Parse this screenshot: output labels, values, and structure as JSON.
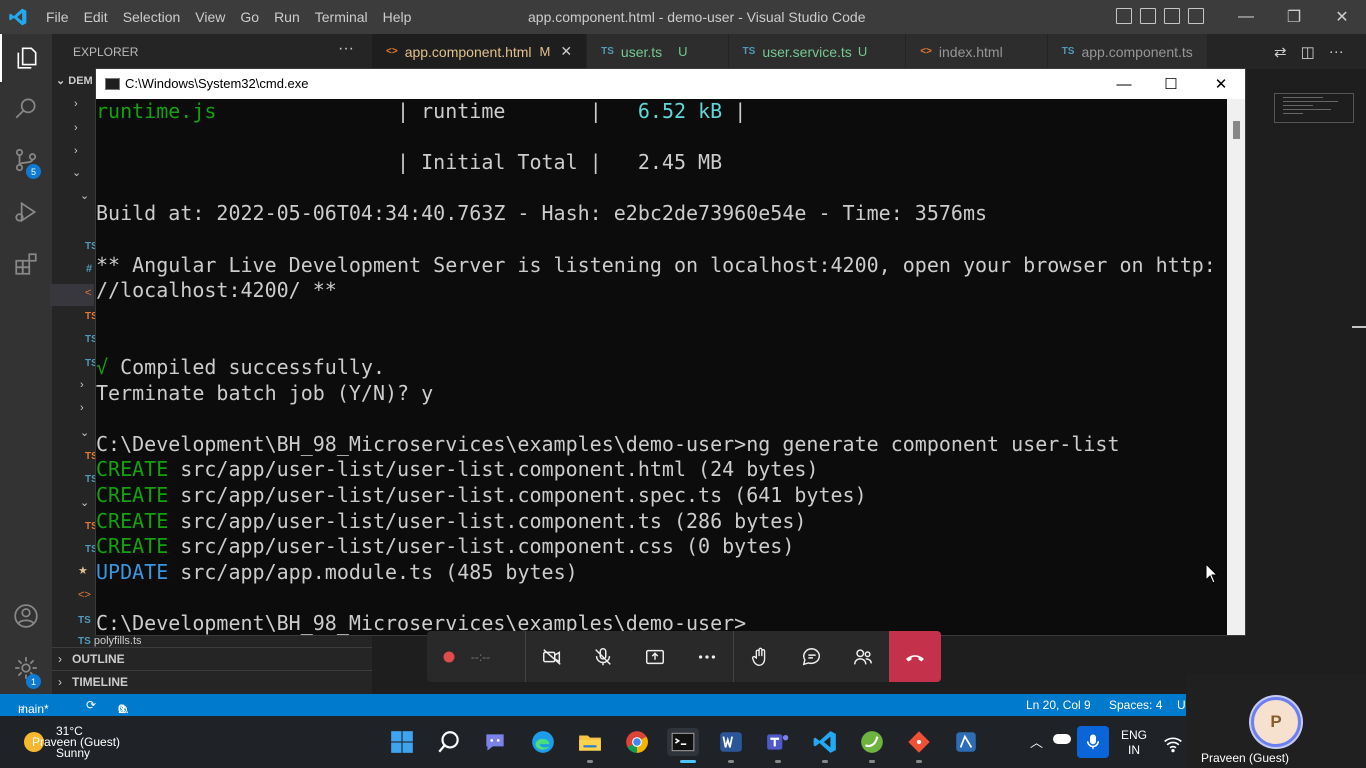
{
  "titlebar": {
    "menu": [
      "File",
      "Edit",
      "Selection",
      "View",
      "Go",
      "Run",
      "Terminal",
      "Help"
    ],
    "title": "app.component.html - demo-user - Visual Studio Code"
  },
  "activity": {
    "scm_badge": "5",
    "settings_badge": "1"
  },
  "sidebar": {
    "header": "EXPLORER",
    "more": "···",
    "root_fragment": "DEM",
    "bottom_file": "polyfills.ts",
    "sections": [
      "OUTLINE",
      "TIMELINE"
    ]
  },
  "tabs": [
    {
      "icon": "<>",
      "label": "app.component.html",
      "status": "M",
      "close": "✕",
      "active": true
    },
    {
      "icon": "TS",
      "label": "user.ts",
      "status": "U",
      "active": false
    },
    {
      "icon": "TS",
      "label": "user.service.ts",
      "status": "U",
      "active": false
    },
    {
      "icon": "<>",
      "label": "index.html",
      "status": "",
      "active": false
    },
    {
      "icon": "TS",
      "label": "app.component.ts",
      "status": "",
      "active": false
    }
  ],
  "cmd": {
    "title": "C:\\Windows\\System32\\cmd.exe",
    "lines": [
      {
        "segs": [
          {
            "t": "runtime.js",
            "c": "g"
          },
          {
            "t": "               | runtime       |   "
          },
          {
            "t": "6.52 kB",
            "c": "c"
          },
          {
            "t": " |"
          }
        ]
      },
      {
        "segs": [
          {
            "t": ""
          }
        ]
      },
      {
        "segs": [
          {
            "t": "                         | Initial Total |   2.45 MB"
          }
        ]
      },
      {
        "segs": [
          {
            "t": ""
          }
        ]
      },
      {
        "segs": [
          {
            "t": "Build at: 2022-05-06T04:34:40.763Z - Hash: e2bc2de73960e54e - Time: 3576ms"
          }
        ]
      },
      {
        "segs": [
          {
            "t": ""
          }
        ]
      },
      {
        "segs": [
          {
            "t": "** Angular Live Development Server is listening on localhost:4200, open your browser on http:"
          }
        ]
      },
      {
        "segs": [
          {
            "t": "//localhost:4200/ **"
          }
        ]
      },
      {
        "segs": [
          {
            "t": ""
          }
        ]
      },
      {
        "segs": [
          {
            "t": ""
          }
        ]
      },
      {
        "segs": [
          {
            "t": "√",
            "c": "g"
          },
          {
            "t": " Compiled successfully."
          }
        ]
      },
      {
        "segs": [
          {
            "t": "Terminate batch job (Y/N)? y"
          }
        ]
      },
      {
        "segs": [
          {
            "t": ""
          }
        ]
      },
      {
        "segs": [
          {
            "t": "C:\\Development\\BH_98_Microservices\\examples\\demo-user>ng generate component user-list"
          }
        ]
      },
      {
        "segs": [
          {
            "t": "CREATE",
            "c": "g"
          },
          {
            "t": " src/app/user-list/user-list.component.html (24 bytes)"
          }
        ]
      },
      {
        "segs": [
          {
            "t": "CREATE",
            "c": "g"
          },
          {
            "t": " src/app/user-list/user-list.component.spec.ts (641 bytes)"
          }
        ]
      },
      {
        "segs": [
          {
            "t": "CREATE",
            "c": "g"
          },
          {
            "t": " src/app/user-list/user-list.component.ts (286 bytes)"
          }
        ]
      },
      {
        "segs": [
          {
            "t": "CREATE",
            "c": "g"
          },
          {
            "t": " src/app/user-list/user-list.component.css (0 bytes)"
          }
        ]
      },
      {
        "segs": [
          {
            "t": "UPDATE",
            "c": "b"
          },
          {
            "t": " src/app/app.module.ts (485 bytes)"
          }
        ]
      },
      {
        "segs": [
          {
            "t": ""
          }
        ]
      },
      {
        "segs": [
          {
            "t": "C:\\Development\\BH_98_Microservices\\examples\\demo-user>_"
          }
        ]
      }
    ]
  },
  "call": {
    "timer": "--:--"
  },
  "statusbar": {
    "branch": "main*",
    "errors": "0",
    "warnings": "0",
    "position": "Ln 20, Col 9",
    "spaces": "Spaces: 4",
    "enc": "U"
  },
  "participant": {
    "initial": "P",
    "name": "Praveen (Guest)"
  },
  "taskbar": {
    "weather_temp": "31°C",
    "weather_name": "Praveen (Guest)",
    "weather_cond": "Sunny",
    "lang_top": "ENG",
    "lang_bottom": "IN"
  }
}
